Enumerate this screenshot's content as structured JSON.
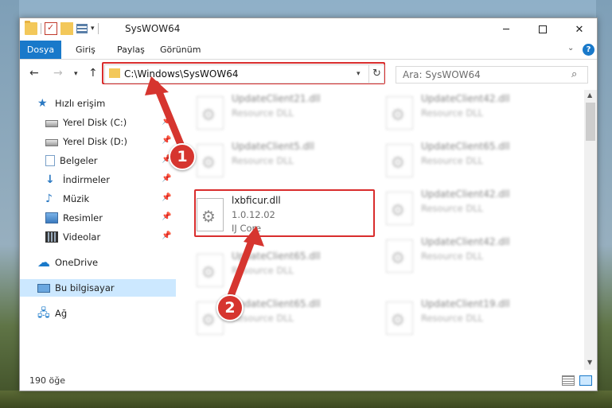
{
  "window": {
    "title": "SysWOW64",
    "minimize": "─",
    "close": "✕"
  },
  "ribbon": {
    "tabs": [
      "Dosya",
      "Giriş",
      "Paylaş",
      "Görünüm"
    ],
    "help": "?"
  },
  "nav": {
    "address": "C:\\Windows\\SysWOW64",
    "search_placeholder": "Ara: SysWOW64"
  },
  "sidebar": {
    "items": [
      {
        "label": "Hızlı erişim"
      },
      {
        "label": "Yerel Disk (C:)"
      },
      {
        "label": "Yerel Disk (D:)"
      },
      {
        "label": "Belgeler"
      },
      {
        "label": "İndirmeler"
      },
      {
        "label": "Müzik"
      },
      {
        "label": "Resimler"
      },
      {
        "label": "Videolar"
      },
      {
        "label": "OneDrive"
      },
      {
        "label": "Bu bilgisayar"
      },
      {
        "label": "Ağ"
      }
    ]
  },
  "files": [
    {
      "name": "UpdateClient21.dll",
      "line2": "Resource DLL",
      "line3": ""
    },
    {
      "name": "UpdateClient42.dll",
      "line2": "Resource DLL",
      "line3": ""
    },
    {
      "name": "UpdateClient5.dll",
      "line2": "Resource DLL",
      "line3": ""
    },
    {
      "name": "UpdateClient65.dll",
      "line2": "Resource DLL",
      "line3": ""
    },
    {
      "name": "lxbficur.dll",
      "line2": "1.0.12.02",
      "line3": "IJ Core"
    },
    {
      "name": "UpdateClient42.dll",
      "line2": "Resource DLL",
      "line3": ""
    },
    {
      "name": "UpdateClient65.dll",
      "line2": "Resource DLL",
      "line3": ""
    },
    {
      "name": "UpdateClient42.dll",
      "line2": "Resource DLL",
      "line3": ""
    },
    {
      "name": "UpdateClient65.dll",
      "line2": "Resource DLL",
      "line3": ""
    },
    {
      "name": "UpdateClient19.dll",
      "line2": "Resource DLL",
      "line3": ""
    }
  ],
  "status": {
    "count": "190 öğe"
  },
  "annotations": {
    "step1": "1",
    "step2": "2"
  },
  "colors": {
    "accent": "#1979ca",
    "highlight": "#d92d2d",
    "callout": "#d6352f"
  }
}
